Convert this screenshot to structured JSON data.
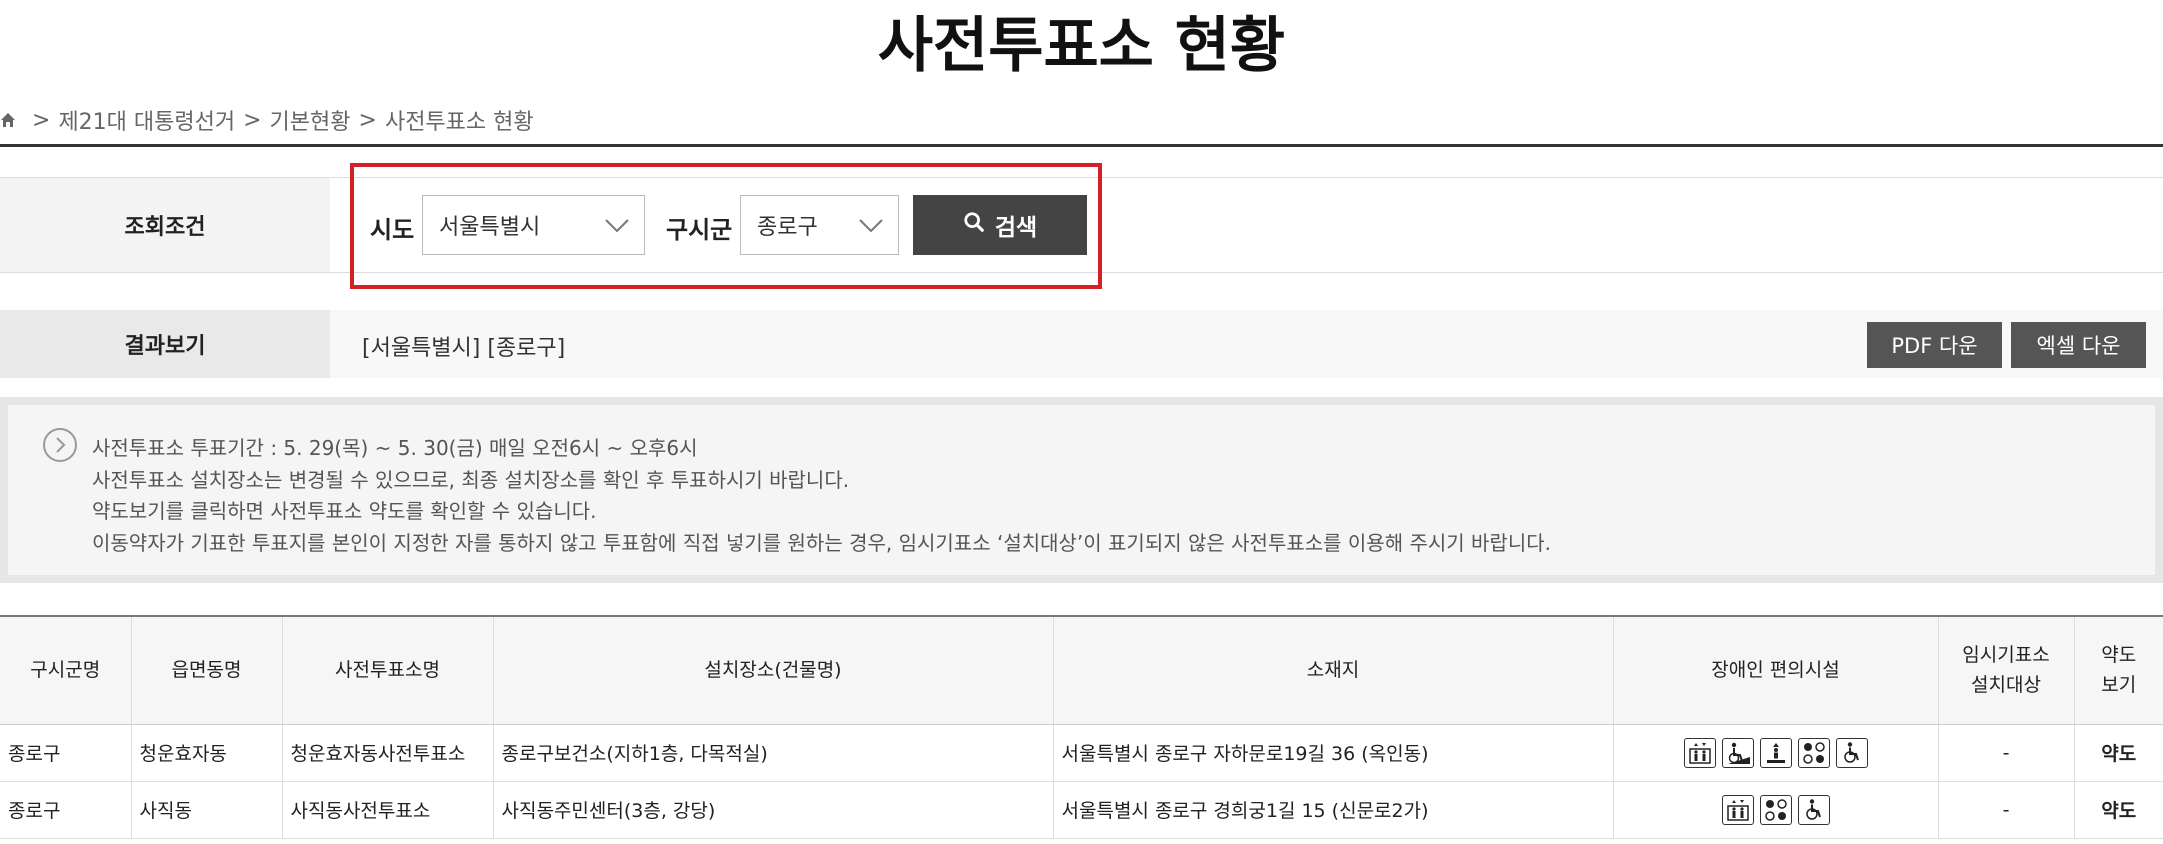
{
  "page": {
    "title": "사전투표소 현황"
  },
  "breadcrumb": {
    "items": [
      "제21대 대통령선거",
      "기본현황",
      "사전투표소 현황"
    ]
  },
  "search": {
    "condition_label": "조회조건",
    "sido_label": "시도",
    "sido_value": "서울특별시",
    "gu_label": "구시군",
    "gu_value": "종로구",
    "search_button": "검색",
    "highlight_color": "#d42027"
  },
  "result": {
    "label": "결과보기",
    "summary": "[서울특별시] [종로구]",
    "pdf_button": "PDF 다운",
    "excel_button": "엑셀 다운"
  },
  "notice": {
    "lines": [
      "사전투표소 투표기간 : 5. 29(목) ~ 5. 30(금) 매일 오전6시 ~ 오후6시",
      "사전투표소 설치장소는 변경될 수 있으므로, 최종 설치장소를 확인 후 투표하시기 바랍니다.",
      "약도보기를 클릭하면 사전투표소 약도를 확인할 수 있습니다.",
      "이동약자가 기표한 투표지를 본인이 지정한 자를 통하지 않고 투표함에 직접 넣기를 원하는 경우, 임시기표소 ‘설치대상’이 표기되지 않은 사전투표소를 이용해 주시기 바랍니다."
    ]
  },
  "table": {
    "headers": {
      "gu": "구시군명",
      "dong": "읍면동명",
      "station": "사전투표소명",
      "place": "설치장소(건물명)",
      "address": "소재지",
      "facility": "장애인 편의시설",
      "temp_line1": "임시기표소",
      "temp_line2": "설치대상",
      "map_line1": "약도",
      "map_line2": "보기"
    },
    "rows": [
      {
        "gu": "종로구",
        "dong": "청운효자동",
        "station": "청운효자동사전투표소",
        "place": "종로구보건소(지하1층, 다목적실)",
        "address": "서울특별시 종로구 자하문로19길 36 (옥인동)",
        "facility_icons": [
          "elevator-icon",
          "wheelchair-ramp-icon",
          "lift-icon",
          "braille-icon",
          "wheelchair-icon"
        ],
        "temp": "-",
        "map": "약도"
      },
      {
        "gu": "종로구",
        "dong": "사직동",
        "station": "사직동사전투표소",
        "place": "사직동주민센터(3층, 강당)",
        "address": "서울특별시 종로구 경희궁1길 15 (신문로2가)",
        "facility_icons": [
          "elevator-icon",
          "braille-icon",
          "wheelchair-icon"
        ],
        "temp": "-",
        "map": "약도"
      }
    ]
  }
}
